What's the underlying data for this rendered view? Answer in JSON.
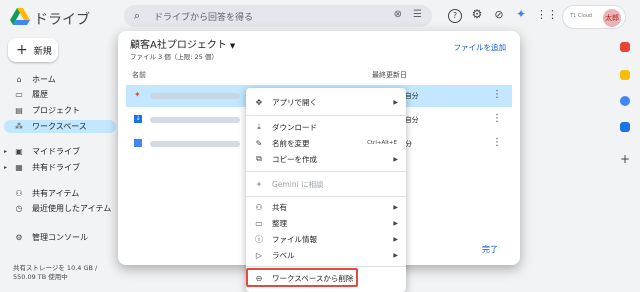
{
  "app": {
    "title": "ドライブ",
    "search_placeholder": "ドライブから回答を得る",
    "account_org": "T1 Cloud",
    "account_initials": "太郎"
  },
  "sidebar": {
    "new_label": "新規",
    "items": [
      {
        "label": "ホーム",
        "icon": "home-icon"
      },
      {
        "label": "履歴",
        "icon": "history-icon"
      },
      {
        "label": "プロジェクト",
        "icon": "project-icon"
      },
      {
        "label": "ワークスペース",
        "icon": "workspace-icon"
      },
      {
        "label": "マイドライブ",
        "icon": "my-drive-icon"
      },
      {
        "label": "共有ドライブ",
        "icon": "shared-drive-icon"
      },
      {
        "label": "共有アイテム",
        "icon": "shared-icon"
      },
      {
        "label": "最近使用したアイテム",
        "icon": "recent-icon"
      },
      {
        "label": "管理コンソール",
        "icon": "admin-icon"
      }
    ],
    "storage_line1": "共有ストレージを 10.4 GB /",
    "storage_line2": "550.09 TB 使用中"
  },
  "dialog": {
    "title": "顧客A社プロジェクト",
    "subtitle": "ファイル 3 個（上限: 25 個）",
    "add_file": "ファイルを追加",
    "col_name": "名前",
    "col_modified": "最終更新日",
    "rows": [
      {
        "date": "7 自分",
        "icon": "gemini-file-icon",
        "selected": true
      },
      {
        "date": "0 自分",
        "icon": "drive-file-icon",
        "selected": false
      },
      {
        "date": "自分",
        "icon": "docs-file-icon",
        "selected": false
      }
    ],
    "done": "完了"
  },
  "menu": {
    "open_with": "アプリで開く",
    "download": "ダウンロード",
    "rename": "名前を変更",
    "rename_shortcut": "Ctrl+Alt+E",
    "copy": "コピーを作成",
    "gemini": "Gemini に相談",
    "share": "共有",
    "organize": "整理",
    "file_info": "ファイル情報",
    "label": "ラベル",
    "remove": "ワークスペースから削除"
  },
  "colors": {
    "accent": "#0b57d0",
    "selected_bg": "#c2e7ff",
    "highlight": "#e5483d"
  }
}
